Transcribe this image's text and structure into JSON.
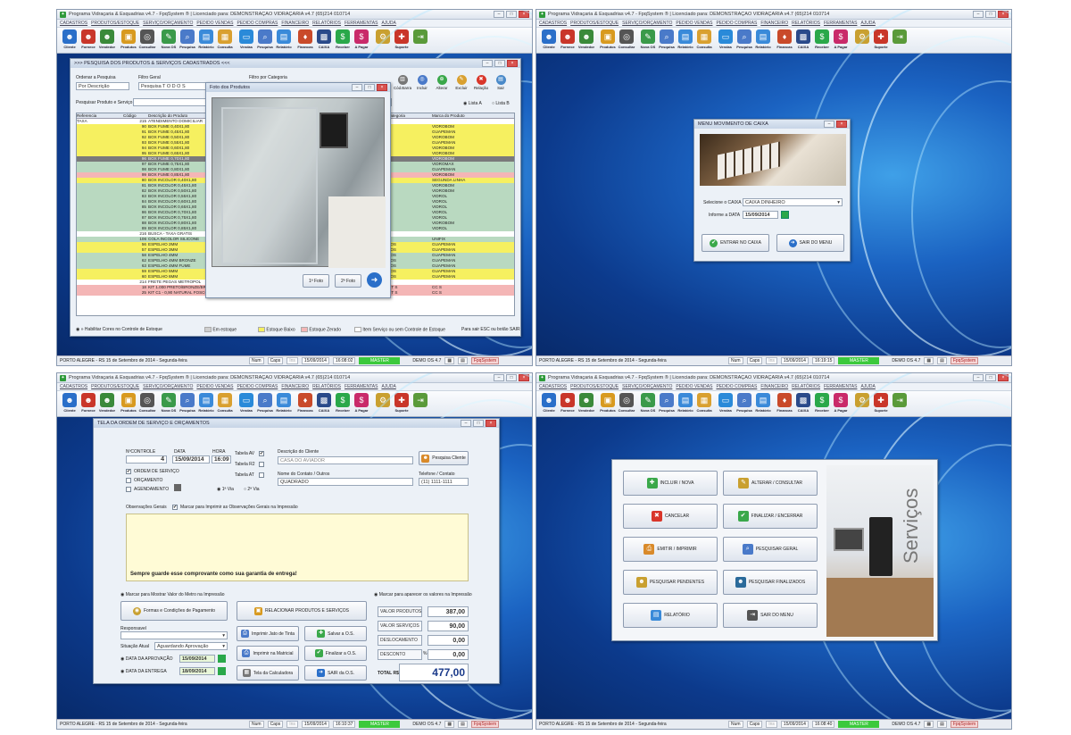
{
  "app": {
    "title": "Programa Vidraçaria & Esquadrias v4.7 - FpqSystem ® | Licenciado para: DEMONSTRAÇÃO VIDRAÇARIA v4.7 (65)214 010714",
    "menu": [
      "CADASTROS",
      "PRODUTOS/ESTOQUE",
      "SERVIÇO/ORÇAMENTO",
      "PEDIDO VENDAS",
      "PEDIDO COMPRAS",
      "FINANCEIRO",
      "RELATÓRIOS",
      "FERRAMENTAS",
      "AJUDA"
    ],
    "toolbar": [
      {
        "label": "Cliente",
        "icon": "client-icon",
        "color": "#2a6fc9"
      },
      {
        "label": "Fornece",
        "icon": "supplier-icon",
        "color": "#c9362a"
      },
      {
        "label": "Vendedor",
        "icon": "seller-icon",
        "color": "#3a8a3a"
      },
      {
        "label": "Produtos",
        "icon": "products-icon",
        "color": "#d89a20"
      },
      {
        "label": "Consultar",
        "icon": "consult-icon",
        "color": "#555555"
      },
      {
        "label": "Nova OS",
        "icon": "new-os-icon",
        "color": "#3a9a4a"
      },
      {
        "label": "Pesquisa",
        "icon": "search-icon",
        "color": "#4a7ac9"
      },
      {
        "label": "Relatório",
        "icon": "report-icon",
        "color": "#3a8ad9"
      },
      {
        "label": "Consulta",
        "icon": "query-icon",
        "color": "#d9a030"
      },
      {
        "label": "Vendas",
        "icon": "sales-icon",
        "color": "#2a8ad9"
      },
      {
        "label": "Pesquisa",
        "icon": "search2-icon",
        "color": "#4a7ac9"
      },
      {
        "label": "Relatório",
        "icon": "report2-icon",
        "color": "#3a8ad9"
      },
      {
        "label": "Financas",
        "icon": "finance-icon",
        "color": "#c94a2a"
      },
      {
        "label": "CAIXA",
        "icon": "cashier-icon",
        "color": "#2a4a8a"
      },
      {
        "label": "Receber",
        "icon": "receive-icon",
        "color": "#2aa84a"
      },
      {
        "label": "A Pagar",
        "icon": "pay-icon",
        "color": "#c92a6a"
      },
      {
        "label": "",
        "icon": "tools-icon",
        "color": "#c9a030"
      },
      {
        "label": "Suporte",
        "icon": "support-icon",
        "color": "#c9362a"
      },
      {
        "label": "",
        "icon": "exit-icon",
        "color": "#5a9a3a"
      }
    ],
    "status": {
      "city": "PORTO ALEGRE - RS 15 de Setembro de 2014 - Segunda-feira",
      "num": "Num",
      "caps": "Caps",
      "ins": "Ins",
      "date": "15/09/2014",
      "master": "MASTER",
      "demo": "DEMO OS 4.7",
      "brand": "FpqSystem"
    },
    "times": [
      "16:08:02",
      "16:19:15",
      "16:10:37",
      "16:08:40"
    ]
  },
  "products": {
    "title": ">>> PESQUISA DOS PRODUTOS & SERVIÇOS CADASTRADOS <<<",
    "order_label": "Ordenar a Pesquisa",
    "order_value": "Por Descrição",
    "filter_label": "Filtro Geral",
    "filter_value": "Pesquisa T O D O S",
    "category_label": "Filtro por Categoria",
    "search_label": "Pesquisar Produto e Serviço",
    "actions": [
      "Cód.Barra",
      "Incluir",
      "Alterar",
      "Excluir",
      "Relação",
      "Sair"
    ],
    "radio_a": "Lista A",
    "radio_b": "Lista B",
    "columns": [
      "Referencia",
      "Código",
      "Descrição do Produto",
      "Categoria",
      "Marca do Produto"
    ],
    "rows": [
      {
        "ref": "TAXA",
        "code": "215",
        "desc": "ATENDIMENTO DOMICILIAR",
        "cat": "",
        "brand": "",
        "bg": "#ffffff"
      },
      {
        "ref": "",
        "code": "90",
        "desc": "BOX FUME 0,40X1,80",
        "cat": "",
        "brand": "VIDROBOM",
        "bg": "#f6f060"
      },
      {
        "ref": "",
        "code": "91",
        "desc": "BOX FUME 0,45X1,80",
        "cat": "",
        "brand": "GUAPEMAN",
        "bg": "#f6f060"
      },
      {
        "ref": "",
        "code": "92",
        "desc": "BOX FUME 0,50X1,80",
        "cat": "",
        "brand": "VIDROBOM",
        "bg": "#f6f060"
      },
      {
        "ref": "",
        "code": "93",
        "desc": "BOX FUME 0,55X1,80",
        "cat": "",
        "brand": "GUAPEMAN",
        "bg": "#f6f060"
      },
      {
        "ref": "",
        "code": "94",
        "desc": "BOX FUME 0,60X1,80",
        "cat": "",
        "brand": "VIDROBOM",
        "bg": "#f6f060"
      },
      {
        "ref": "",
        "code": "95",
        "desc": "BOX FUME 0,65X1,80",
        "cat": "",
        "brand": "VIDROBOM",
        "bg": "#f6f060"
      },
      {
        "ref": "",
        "code": "96",
        "desc": "BOX FUME 0,70X1,80",
        "cat": "",
        "brand": "VIDROBOM",
        "bg": "#7a7a7a"
      },
      {
        "ref": "",
        "code": "97",
        "desc": "BOX FUME 0,75X1,80",
        "cat": "",
        "brand": "VIDROMAX",
        "bg": "#b9d9c0"
      },
      {
        "ref": "",
        "code": "98",
        "desc": "BOX FUME 0,80X1,80",
        "cat": "",
        "brand": "GUAPEMAN",
        "bg": "#b9d9c0"
      },
      {
        "ref": "",
        "code": "99",
        "desc": "BOX FUME 0,85X1,80",
        "cat": "",
        "brand": "VIDROBOM",
        "bg": "#f4b6b6"
      },
      {
        "ref": "",
        "code": "80",
        "desc": "BOX INCOLOR 0,40X1,80",
        "cat": "",
        "brand": "SEGUNDA LINHA",
        "bg": "#f6f060"
      },
      {
        "ref": "",
        "code": "81",
        "desc": "BOX INCOLOR 0,45X1,80",
        "cat": "",
        "brand": "VIDROBOM",
        "bg": "#b9d9c0"
      },
      {
        "ref": "",
        "code": "82",
        "desc": "BOX INCOLOR 0,50X1,80",
        "cat": "",
        "brand": "VIDROBOM",
        "bg": "#b9d9c0"
      },
      {
        "ref": "",
        "code": "83",
        "desc": "BOX INCOLOR 0,55X1,80",
        "cat": "",
        "brand": "VIDROL",
        "bg": "#b9d9c0"
      },
      {
        "ref": "",
        "code": "84",
        "desc": "BOX INCOLOR 0,60X1,80",
        "cat": "",
        "brand": "VIDROL",
        "bg": "#b9d9c0"
      },
      {
        "ref": "",
        "code": "85",
        "desc": "BOX INCOLOR 0,65X1,80",
        "cat": "",
        "brand": "VIDROL",
        "bg": "#b9d9c0"
      },
      {
        "ref": "",
        "code": "86",
        "desc": "BOX INCOLOR 0,70X1,80",
        "cat": "",
        "brand": "VIDROL",
        "bg": "#b9d9c0"
      },
      {
        "ref": "",
        "code": "87",
        "desc": "BOX INCOLOR 0,75X1,80",
        "cat": "",
        "brand": "VIDROL",
        "bg": "#b9d9c0"
      },
      {
        "ref": "",
        "code": "88",
        "desc": "BOX INCOLOR 0,80X1,80",
        "cat": "",
        "brand": "VIDROBOM",
        "bg": "#b9d9c0"
      },
      {
        "ref": "",
        "code": "89",
        "desc": "BOX INCOLOR 0,85X1,80",
        "cat": "",
        "brand": "VIDROL",
        "bg": "#b9d9c0"
      },
      {
        "ref": "",
        "code": "216",
        "desc": "BUSCA - TAXA GRATIS",
        "cat": "",
        "brand": "",
        "bg": "#ffffff"
      },
      {
        "ref": "",
        "code": "106",
        "desc": "COLA INCOLOR SILICONE",
        "cat": "",
        "brand": "UNIFIX",
        "bg": "#b9d9c0"
      },
      {
        "ref": "",
        "code": "56",
        "desc": "ESPELHO 2MM",
        "cat": "HOS",
        "brand": "GUAPEMAN",
        "bg": "#f6f060"
      },
      {
        "ref": "",
        "code": "57",
        "desc": "ESPELHO 3MM",
        "cat": "HOS",
        "brand": "GUAPEMAN",
        "bg": "#f6f060"
      },
      {
        "ref": "",
        "code": "58",
        "desc": "ESPELHO 4MM",
        "cat": "HOS",
        "brand": "GUAPEMAN",
        "bg": "#b9d9c0"
      },
      {
        "ref": "",
        "code": "62",
        "desc": "ESPELHO 4MM BRONZE",
        "cat": "HOS",
        "brand": "GUAPEMAN",
        "bg": "#b9d9c0"
      },
      {
        "ref": "",
        "code": "63",
        "desc": "ESPELHO 4MM FUME",
        "cat": "HOS",
        "brand": "GUAPEMAN",
        "bg": "#b9d9c0"
      },
      {
        "ref": "",
        "code": "59",
        "desc": "ESPELHO 5MM",
        "cat": "HOS",
        "brand": "GUAPEMAN",
        "bg": "#f6f060"
      },
      {
        "ref": "",
        "code": "60",
        "desc": "ESPELHO 6MM",
        "cat": "HOS",
        "brand": "GUAPEMAN",
        "bg": "#f6f060"
      },
      {
        "ref": "",
        "code": "214",
        "desc": "FRETE PEGAS METROPOL",
        "cat": "",
        "brand": "",
        "bg": "#ffffff"
      },
      {
        "ref": "",
        "code": "18",
        "desc": "KIT 1.000 PRETO/BRONZE/BRANCO",
        "cat": "KIT S",
        "brand": "CC S",
        "bg": "#f4b6b6"
      },
      {
        "ref": "",
        "code": "25",
        "desc": "KIT C1 - 0,90 NATURAL FOSCO",
        "cat": "KIT S",
        "brand": "CC S",
        "bg": "#f4b6b6"
      }
    ],
    "row_unit": "UNI",
    "row_price_a": "63,00",
    "row_price_b": "105,00",
    "legend": [
      "» Habilitar Cores no Controle de Estoque",
      "Em estoque",
      "Estoque Baixo",
      "Estoque Zerado",
      "Item Serviço ou sem Controle de Estoque",
      "Para sair ESC ou botão SAIR"
    ],
    "photo": {
      "title": "Foto dos Produtos",
      "btn1": "1ª Foto",
      "btn2": "2ª Foto"
    }
  },
  "cash": {
    "title": "MENU MOVIMENTO DE CAIXA",
    "select_label": "Selecione o CAIXA",
    "select_value": "CAIXA DINHEIRO",
    "date_label": "Informe a DATA",
    "date_value": "15/09/2014",
    "enter": "ENTRAR NO CAIXA",
    "exit": "SAIR DO MENU"
  },
  "os": {
    "title": "TELA DA ORDEM DE SERVIÇO E ORÇAMENTOS",
    "control_label": "NºCONTROLE",
    "control": "4",
    "date_label": "DATA",
    "date": "15/09/2014",
    "time_label": "HORA",
    "time": "16:09",
    "chk_os": "ORDEM DE SERVIÇO",
    "chk_orc": "ORÇAMENTO",
    "chk_ag": "AGENDAMENTO",
    "tab_av": "Tabela AV",
    "tab_r2": "Tabela R2",
    "tab_at": "Tabela AT",
    "via1": "1ª Via",
    "via2": "2ª Via",
    "client_label": "Descrição do Cliente",
    "client": "CASA DO AVIADOR",
    "client_btn": "Pesquisa Cliente",
    "contact_label": "Nome do Contato / Outros",
    "contact": "QUADRADO",
    "phone_label": "Telefone / Contato",
    "phone": "(11) 1111-1111",
    "obs_label": "Observações Gerais",
    "obs_chk": "Marcar para Imprimir as Observações Gerais na Impressão",
    "obs_note": "Sempre guarde esse comprovante como sua garantia de entrega!",
    "meter_chk": "Marcar para Mostrar Valor do Metro na Impressão",
    "values_chk": "Marcar para aparecer os valores na Impressão",
    "payment_btn": "Formas e Condições de Pagamento",
    "relate_btn": "RELACIONAR PRODUTOS E SERVIÇOS",
    "relate_sub": "Produtos",
    "resp_label": "Responsavel",
    "status_label": "Situação Atual",
    "status_value": "Aguardando Aprovação",
    "approve_label": "DATA DA APROVAÇÃO",
    "approve": "15/09/2014",
    "delivery_label": "DATA DA ENTREGA",
    "delivery": "18/09/2014",
    "print_text": "Imprimir Jato de Tinta",
    "print_matrix": "Imprimir na Matricial",
    "calc": "Tela da Calculadora",
    "save": "Salvar a O.S.",
    "finish": "Finalizar a O.S.",
    "exit": "SAIR da O.S.",
    "v_prod_label": "VALOR PRODUTOS",
    "v_prod": "387,00",
    "v_serv_label": "VALOR SERVIÇOS",
    "v_serv": "90,00",
    "disp_label": "DESLOCAMENTO",
    "disp": "0,00",
    "disc_label": "DESCONTO",
    "disc_pct": "%",
    "disc": "0,00",
    "total_label": "TOTAL R$",
    "total": "477,00"
  },
  "services": {
    "side_text": "Serviços",
    "buttons": [
      {
        "label": "INCLUIR / NOVA",
        "icon": "add-icon",
        "color": "#3aa84a"
      },
      {
        "label": "ALTERAR / CONSULTAR",
        "icon": "edit-icon",
        "color": "#c9a030"
      },
      {
        "label": "CANCELAR",
        "icon": "cancel-icon",
        "color": "#d9362a"
      },
      {
        "label": "FINALIZAR / ENCERRAR",
        "icon": "check-icon",
        "color": "#3aa84a"
      },
      {
        "label": "EMITIR / IMPRIMIR",
        "icon": "print-icon",
        "color": "#d98a2a"
      },
      {
        "label": "PESQUISAR GERAL",
        "icon": "search-icon",
        "color": "#4a7ac9"
      },
      {
        "label": "PESQUISAR PENDENTES",
        "icon": "pending-icon",
        "color": "#c9a030"
      },
      {
        "label": "PESQUISAR FINALIZADOS",
        "icon": "finished-icon",
        "color": "#2a6a9a"
      },
      {
        "label": "RELATÓRIO",
        "icon": "report-icon",
        "color": "#3a8ad9"
      },
      {
        "label": "SAIR DO MENU",
        "icon": "exit-icon",
        "color": "#555555"
      }
    ]
  }
}
